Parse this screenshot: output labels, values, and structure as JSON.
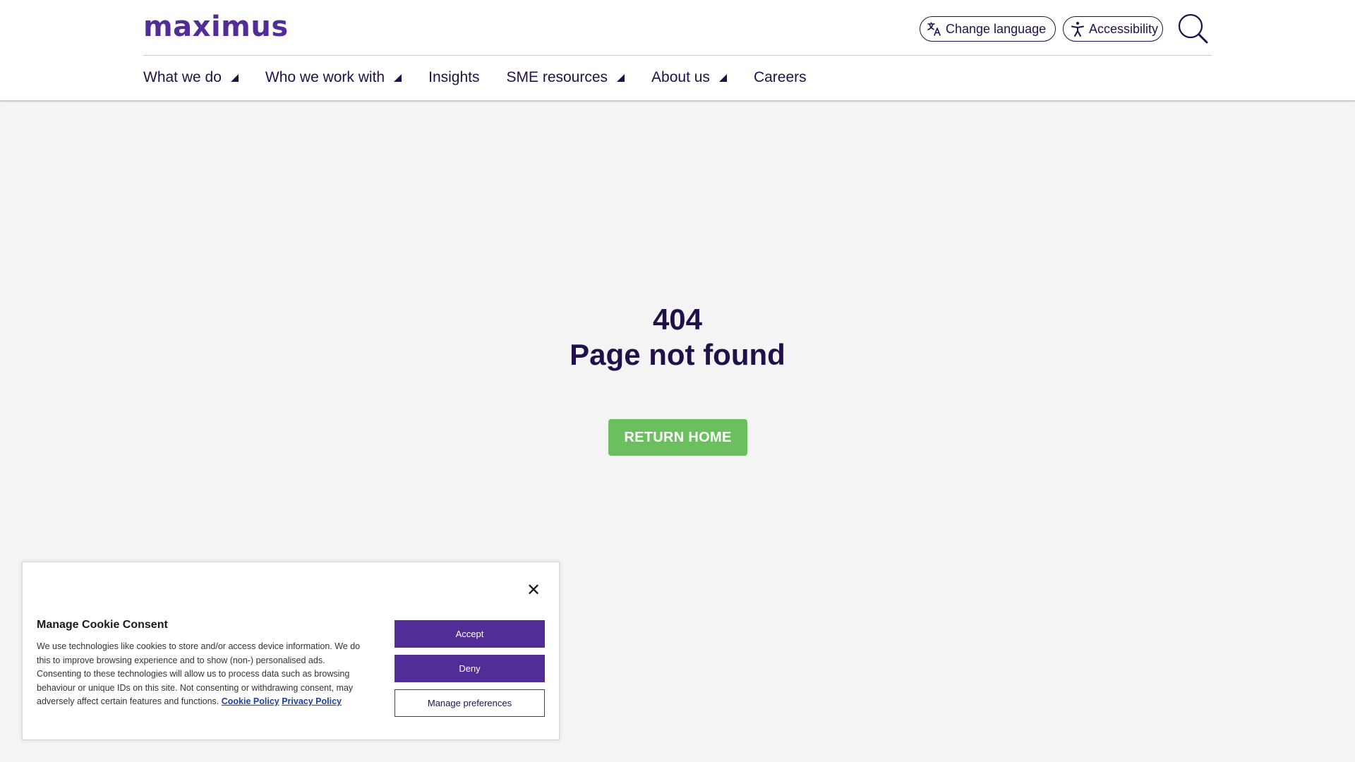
{
  "header": {
    "logo_text": "maximus",
    "change_language_label": "Change language",
    "accessibility_label": "Accessibility",
    "nav": [
      {
        "label": "What we do",
        "dropdown": true
      },
      {
        "label": "Who we work with",
        "dropdown": true
      },
      {
        "label": "Insights",
        "dropdown": false
      },
      {
        "label": "SME resources",
        "dropdown": true
      },
      {
        "label": "About us",
        "dropdown": true
      },
      {
        "label": "Careers",
        "dropdown": false
      }
    ]
  },
  "main": {
    "error_code": "404",
    "error_message": "Page not found",
    "return_home_label": "RETURN HOME"
  },
  "cookie": {
    "title": "Manage Cookie Consent",
    "body": "We use technologies like cookies to store and/or access device information. We do this to improve browsing experience and to show (non-) personalised ads. Consenting to these technologies will allow us to process data such as browsing behaviour or unique IDs on this site. Not consenting or withdrawing consent, may adversely affect certain features and functions.",
    "cookie_policy_link": "Cookie Policy",
    "privacy_policy_link": "Privacy Policy",
    "accept_label": "Accept",
    "deny_label": "Deny",
    "manage_label": "Manage preferences",
    "close_symbol": "✕"
  },
  "colors": {
    "brand_purple": "#522d98",
    "dark_purple": "#22104a",
    "return_green": "#6cbf5f",
    "page_bg": "#f4f4f4"
  },
  "icons": [
    "translate-icon",
    "accessibility-icon",
    "search-icon",
    "close-icon",
    "caret-icon"
  ]
}
